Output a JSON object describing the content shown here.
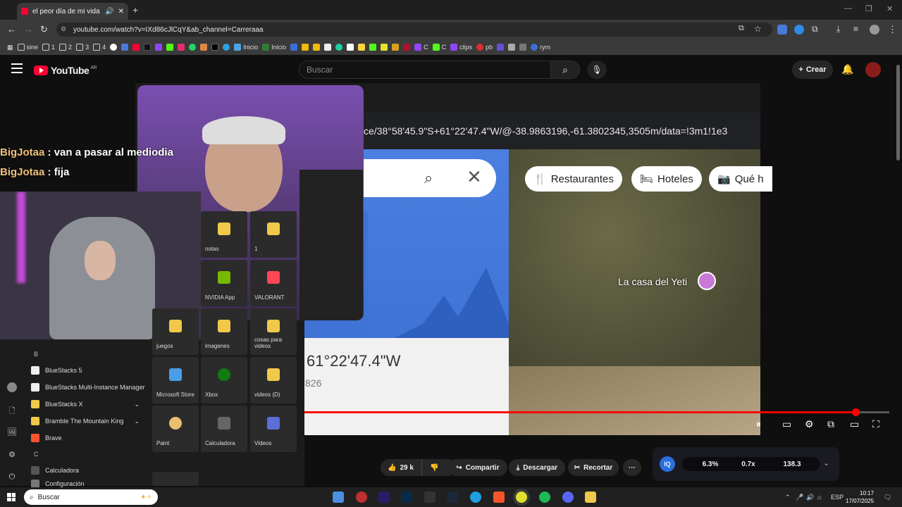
{
  "browser": {
    "tab_title": "el peor día de mi vida 🔴 -",
    "url": "youtube.com/watch?v=IXd86cJlCqY&ab_channel=Carreraaa",
    "new_tab": "+",
    "bookmarks": [
      "sine",
      "1",
      "2",
      "3",
      "4",
      "Inicio",
      "Inicio",
      "C",
      "C",
      "clips",
      "pb",
      "rym"
    ]
  },
  "youtube": {
    "logo_text": "YouTube",
    "region": "AR",
    "search_placeholder": "Buscar",
    "create_label": "Crear",
    "actions": {
      "likes": "29 k",
      "share": "Compartir",
      "download": "Descargar",
      "clip": "Recortar",
      "more": "···"
    },
    "progress": 0.942
  },
  "video": {
    "maps_url_fragment": "ce/38°58'45.9\"S+61°22'47.4\"W/@-38.9863196,-61.3802345,3505m/data=!3m1!1e3",
    "chips": [
      "Restaurantes",
      "Hoteles",
      "Qué h"
    ],
    "place_label": "La casa del Yeti",
    "coord_main": "61°22'47.4\"W",
    "coord_sub": "826",
    "chat": [
      {
        "user": "BigJotaa",
        "msg": " : van a pasar al mediodia"
      },
      {
        "user": "BigJotaa",
        "msg": " : fija"
      }
    ]
  },
  "start_menu": {
    "letters": [
      "B",
      "C"
    ],
    "apps": [
      "BlueStacks 5",
      "BlueStacks Multi-Instance Manager",
      "BlueStacks X",
      "Bramble The Mountain King",
      "Brave",
      "Calculadora",
      "Configuración"
    ],
    "tiles": [
      "notas",
      "1",
      "NVIDIA App",
      "VALORANT",
      "juegos",
      "imagenes",
      "cosas para videos",
      "Microsoft Store",
      "Xbox",
      "videos (D)",
      "Paint",
      "Calculadora",
      "Videos"
    ]
  },
  "extension": {
    "badge": "IQ",
    "values": [
      "6.3%",
      "0.7x",
      "138.3"
    ]
  },
  "taskbar": {
    "search_text": "Buscar",
    "lang": "ESP",
    "time": "10:17",
    "date": "17/07/2025"
  },
  "colors": {
    "accent_red": "#ff0033",
    "maps_blue": "#3f73d6"
  }
}
